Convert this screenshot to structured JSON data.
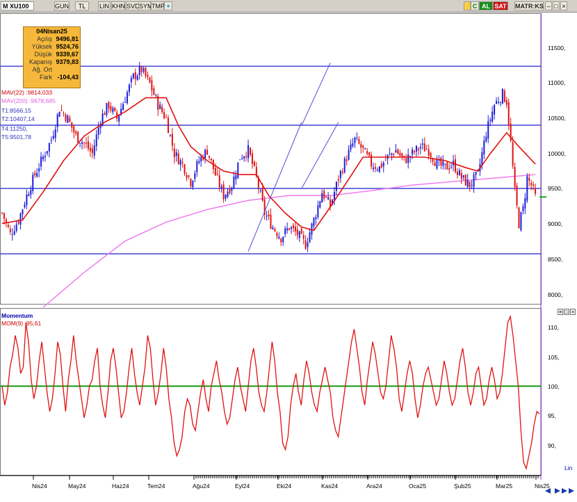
{
  "toolbar": {
    "symbol": "XU100",
    "buttons": [
      "GUN",
      "TL",
      "LIN",
      "KHN",
      "SVD",
      "SYM",
      "TMP"
    ],
    "al_label": "AL",
    "sat_label": "SAT",
    "matriks_label": "MATR:KS",
    "c_label": "C"
  },
  "info_box": {
    "date": "04Nisan25",
    "rows": [
      {
        "label": "Açılış",
        "value": "9496,81"
      },
      {
        "label": "Yüksek",
        "value": "9524,76"
      },
      {
        "label": "Düşük",
        "value": "9339,67"
      },
      {
        "label": "Kapanış",
        "value": "9379,83"
      },
      {
        "label": "Ağ. Ort",
        "value": ""
      },
      {
        "label": "Fark",
        "value": "-104,43"
      }
    ]
  },
  "legend": {
    "mav22_label": "MAV(22)",
    "mav22_value": ":9814,033",
    "mav200_label": "MAV(200)",
    "mav200_value": ":9678,685",
    "t1": "T1:8566,15",
    "t2": "T2:10407,14",
    "t4": "T4:11250,",
    "t5": "T5:9501,78"
  },
  "momentum_panel": {
    "title": "Momentum",
    "label": "MOM(9)",
    "value": ":95,61",
    "scale_label": "Lin"
  },
  "colors": {
    "up_candle": "#1c1cd6",
    "down_candle": "#e01010",
    "mav22": "#e01010",
    "mav200": "#f07cf0",
    "hline": "#5050d8",
    "trend": "#5050d8",
    "momentum": "#e01010",
    "mom_ref": "#119911"
  },
  "chart_data": [
    {
      "type": "candlestick",
      "title": "XU100",
      "x_ticks": [
        "Nis24",
        "May24",
        "Haz24",
        "Tem24",
        "Ağu24",
        "Eyl24",
        "Eki24",
        "Kas24",
        "Ara24",
        "Oca25",
        "Şub25",
        "Mar25",
        "Nis25"
      ],
      "y_ticks": [
        "11500,",
        "11000,",
        "10500,",
        "10000,",
        "9500,",
        "9000,",
        "8500,",
        "8000,"
      ],
      "ylim": [
        7850,
        12000
      ],
      "horizontal_levels": [
        8566.15,
        9501.78,
        10407.14,
        11250
      ],
      "close_path": [
        [
          0,
          9150
        ],
        [
          4,
          8850
        ],
        [
          8,
          9050
        ],
        [
          12,
          9400
        ],
        [
          16,
          9700
        ],
        [
          20,
          9950
        ],
        [
          24,
          10200
        ],
        [
          28,
          10650
        ],
        [
          32,
          10500
        ],
        [
          36,
          10250
        ],
        [
          40,
          10150
        ],
        [
          44,
          10000
        ],
        [
          48,
          10500
        ],
        [
          52,
          10700
        ],
        [
          56,
          10500
        ],
        [
          60,
          10800
        ],
        [
          64,
          11100
        ],
        [
          68,
          11200
        ],
        [
          72,
          11000
        ],
        [
          76,
          10700
        ],
        [
          80,
          10500
        ],
        [
          84,
          10000
        ],
        [
          88,
          9850
        ],
        [
          92,
          9600
        ],
        [
          96,
          9900
        ],
        [
          100,
          10050
        ],
        [
          104,
          9700
        ],
        [
          108,
          9400
        ],
        [
          112,
          9550
        ],
        [
          116,
          9950
        ],
        [
          120,
          10050
        ],
        [
          124,
          9650
        ],
        [
          128,
          9150
        ],
        [
          132,
          8950
        ],
        [
          136,
          8800
        ],
        [
          140,
          8950
        ],
        [
          144,
          8850
        ],
        [
          148,
          8700
        ],
        [
          152,
          9050
        ],
        [
          156,
          9450
        ],
        [
          160,
          9250
        ],
        [
          164,
          9650
        ],
        [
          168,
          9950
        ],
        [
          172,
          10200
        ],
        [
          176,
          10050
        ],
        [
          180,
          9850
        ],
        [
          184,
          9800
        ],
        [
          188,
          9950
        ],
        [
          192,
          10050
        ],
        [
          196,
          9900
        ],
        [
          200,
          10000
        ],
        [
          204,
          10100
        ],
        [
          208,
          10050
        ],
        [
          212,
          9850
        ],
        [
          216,
          9800
        ],
        [
          220,
          9850
        ],
        [
          224,
          9650
        ],
        [
          228,
          9550
        ],
        [
          232,
          9700
        ],
        [
          236,
          10300
        ],
        [
          240,
          10700
        ],
        [
          244,
          10850
        ],
        [
          246,
          10750
        ],
        [
          248,
          10150
        ],
        [
          250,
          9450
        ],
        [
          252,
          9000
        ],
        [
          254,
          9200
        ],
        [
          256,
          9650
        ],
        [
          258,
          9550
        ],
        [
          260,
          9380
        ]
      ],
      "mav22_path": [
        [
          0,
          9000
        ],
        [
          10,
          9050
        ],
        [
          20,
          9450
        ],
        [
          30,
          9900
        ],
        [
          40,
          10250
        ],
        [
          50,
          10450
        ],
        [
          60,
          10600
        ],
        [
          70,
          10800
        ],
        [
          80,
          10800
        ],
        [
          86,
          10400
        ],
        [
          92,
          10100
        ],
        [
          100,
          9900
        ],
        [
          108,
          9750
        ],
        [
          116,
          9700
        ],
        [
          124,
          9700
        ],
        [
          130,
          9400
        ],
        [
          138,
          9150
        ],
        [
          146,
          8950
        ],
        [
          152,
          8900
        ],
        [
          158,
          9150
        ],
        [
          166,
          9500
        ],
        [
          176,
          9950
        ],
        [
          186,
          9950
        ],
        [
          196,
          9950
        ],
        [
          206,
          9950
        ],
        [
          216,
          9900
        ],
        [
          226,
          9800
        ],
        [
          232,
          9750
        ],
        [
          238,
          10000
        ],
        [
          246,
          10300
        ],
        [
          252,
          10100
        ],
        [
          260,
          9850
        ]
      ],
      "mav200_path": [
        [
          20,
          7800
        ],
        [
          40,
          8300
        ],
        [
          60,
          8750
        ],
        [
          80,
          9020
        ],
        [
          100,
          9200
        ],
        [
          120,
          9330
        ],
        [
          140,
          9400
        ],
        [
          160,
          9400
        ],
        [
          180,
          9470
        ],
        [
          200,
          9550
        ],
        [
          220,
          9600
        ],
        [
          240,
          9650
        ],
        [
          260,
          9700
        ]
      ],
      "trend_lines": [
        {
          "from": [
            120,
            8600
          ],
          "to": [
            146,
            10450
          ]
        },
        {
          "from": [
            146,
            10400
          ],
          "to": [
            160,
            11300
          ]
        },
        {
          "from": [
            146,
            9500
          ],
          "to": [
            164,
            10450
          ]
        }
      ],
      "x_range": [
        0,
        262
      ]
    },
    {
      "type": "line",
      "title": "Momentum",
      "series": [
        {
          "name": "MOM(9)",
          "values": [
            100,
            97,
            99,
            103,
            105,
            108,
            106,
            102,
            103,
            110,
            107,
            101,
            98,
            100,
            104,
            107,
            103,
            99,
            96,
            98,
            102,
            107,
            105,
            100,
            96,
            101,
            104,
            108,
            104,
            101,
            98,
            95,
            97,
            100,
            101,
            104,
            106,
            100,
            97,
            95,
            99,
            104,
            106,
            103,
            99,
            95,
            96,
            99,
            103,
            106,
            102,
            99,
            97,
            100,
            103,
            108,
            106,
            101,
            97,
            99,
            102,
            106,
            103,
            98,
            95,
            91,
            89,
            90,
            92,
            96,
            98,
            97,
            94,
            93,
            96,
            99,
            101,
            98,
            96,
            100,
            102,
            104,
            101,
            99,
            96,
            94,
            95,
            98,
            101,
            103,
            100,
            98,
            96,
            100,
            104,
            106,
            103,
            99,
            97,
            96,
            99,
            103,
            107,
            104,
            99,
            96,
            91,
            90,
            92,
            97,
            100,
            102,
            99,
            97,
            101,
            104,
            102,
            99,
            97,
            96,
            99,
            101,
            103,
            101,
            99,
            95,
            93,
            92,
            95,
            98,
            101,
            104,
            107,
            109,
            106,
            103,
            99,
            97,
            101,
            104,
            107,
            105,
            102,
            99,
            98,
            100,
            104,
            108,
            106,
            103,
            98,
            96,
            99,
            102,
            104,
            102,
            98,
            95,
            97,
            100,
            102,
            103,
            101,
            99,
            97,
            98,
            101,
            104,
            102,
            99,
            97,
            98,
            101,
            104,
            106,
            103,
            99,
            97,
            99,
            102,
            103,
            100,
            97,
            98,
            101,
            103,
            101,
            98,
            99,
            102,
            106,
            110,
            111,
            108,
            104,
            100,
            93,
            88,
            87,
            89,
            91,
            94,
            96,
            95.61
          ]
        }
      ],
      "ylim": [
        86,
        112
      ],
      "y_ticks": [
        "110,",
        "105,",
        "100,",
        "95,",
        "90,"
      ],
      "reference_line": 100
    }
  ]
}
